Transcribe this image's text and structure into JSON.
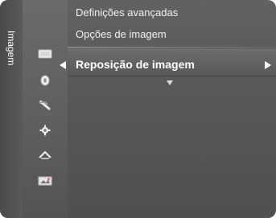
{
  "sidebar": {
    "category": "Imagem",
    "icons": [
      "picture-icon",
      "sound-icon",
      "channel-icon",
      "setup-icon",
      "input-icon",
      "application-icon"
    ]
  },
  "menu": {
    "items": [
      {
        "label": "Definições avançadas"
      },
      {
        "label": "Opções de imagem"
      },
      {
        "label": "Reposição de imagem"
      }
    ],
    "selected_index": 2
  },
  "colors": {
    "accent": "#ffffff",
    "panel": "#5c5c5c",
    "rail": "#4a4a4a"
  }
}
